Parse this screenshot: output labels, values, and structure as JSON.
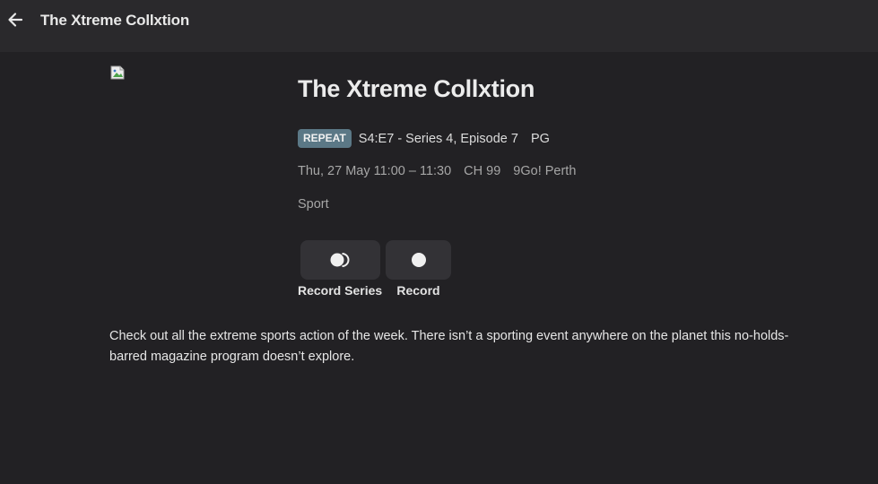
{
  "header": {
    "back_icon": "arrow-left-icon",
    "title": "The Xtreme Collxtion"
  },
  "program": {
    "title": "The Xtreme Collxtion",
    "badge": "REPEAT",
    "episode": "S4:E7 - Series 4, Episode 7",
    "rating": "PG",
    "time": "Thu, 27 May 11:00 – 11:30",
    "channel_number": "CH 99",
    "channel_name": "9Go! Perth",
    "genre": "Sport",
    "description": "Check out all the extreme sports action of the week. There isn’t a sporting event anywhere on the planet this no-holds-barred magazine program doesn’t explore."
  },
  "actions": {
    "record_series_label": "Record Series",
    "record_series_icon": "record-series-icon",
    "record_label": "Record",
    "record_icon": "record-icon"
  },
  "colors": {
    "background": "#222124",
    "header": "#2a292c",
    "badge": "#5b7886",
    "button": "#333236"
  }
}
